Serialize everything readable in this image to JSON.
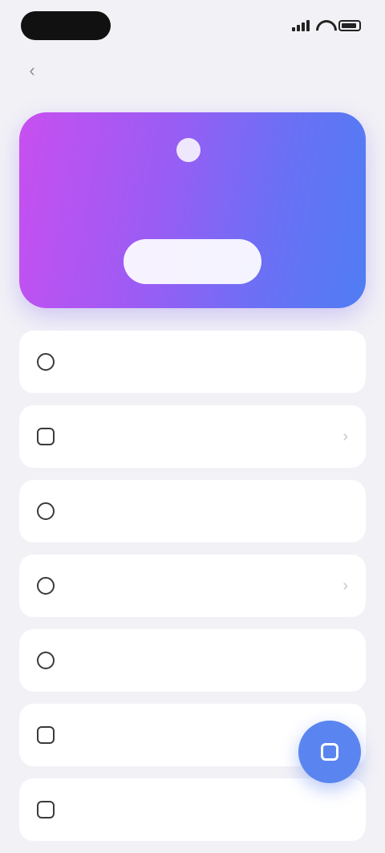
{
  "status_bar": {
    "time": ""
  },
  "nav": {
    "title": ""
  },
  "hero": {
    "title": "",
    "description": "",
    "button_label": ""
  },
  "menu": {
    "items": [
      {
        "label": ""
      },
      {
        "label": ""
      },
      {
        "label": ""
      },
      {
        "label": ""
      },
      {
        "label": ""
      },
      {
        "label": ""
      },
      {
        "label": ""
      }
    ]
  },
  "icons": {
    "back": "chevron-left-icon",
    "fab": "compose-icon"
  },
  "colors": {
    "background": "#f2f1f6",
    "hero_gradient_start": "#c84ff0",
    "hero_gradient_end": "#4f7df4",
    "fab": "#5a85f0",
    "card": "#ffffff"
  }
}
